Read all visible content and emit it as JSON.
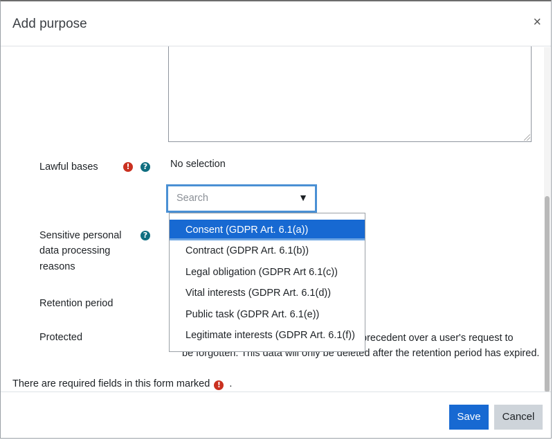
{
  "modal": {
    "title": "Add purpose",
    "close_glyph": "×"
  },
  "fields": {
    "lawful_bases_label": "Lawful bases",
    "no_selection": "No selection",
    "search_placeholder": "Search",
    "dropdown_arrow": "▼",
    "sensitive_label_lines": [
      "Sensitive personal",
      "data processing",
      "reasons"
    ],
    "retention_label": "Retention period",
    "protected_label": "Protected",
    "protected_text_line1": "precedent over a user's request to",
    "protected_text_line2": "be forgotten. This data will only be deleted after the retention period has expired."
  },
  "lawful_bases_options": [
    {
      "label": "Consent (GDPR Art. 6.1(a))",
      "selected": true
    },
    {
      "label": "Contract (GDPR Art. 6.1(b))",
      "selected": false
    },
    {
      "label": "Legal obligation (GDPR Art 6.1(c))",
      "selected": false
    },
    {
      "label": "Vital interests (GDPR Art. 6.1(d))",
      "selected": false
    },
    {
      "label": "Public task (GDPR Art. 6.1(e))",
      "selected": false
    },
    {
      "label": "Legitimate interests (GDPR Art. 6.1(f))",
      "selected": false
    }
  ],
  "icons": {
    "required": "!",
    "help": "?"
  },
  "required_note": {
    "text": "There are required fields in this form marked",
    "suffix": "."
  },
  "footer": {
    "save_label": "Save",
    "cancel_label": "Cancel"
  },
  "colors": {
    "accent": "#1769d2",
    "required_icon": "#ca3120",
    "help_icon": "#0f6e80",
    "focus_border": "#4a90d4"
  }
}
